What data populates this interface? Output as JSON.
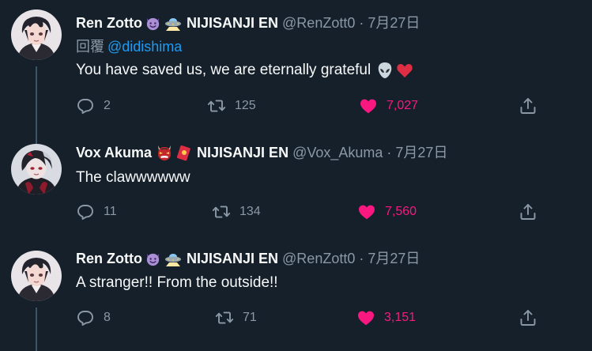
{
  "tweets": [
    {
      "display_name": "Ren Zotto",
      "emojis": [
        "smiling-devil-emoji",
        "ufo-emoji"
      ],
      "org": "NIJISANJI EN",
      "handle": "@RenZott0",
      "separator": "·",
      "date": "7月27日",
      "reply_prefix": "回覆",
      "reply_to": "@didishima",
      "text": "You have saved us, we are eternally grateful",
      "text_emojis": [
        "alien-emoji",
        "red-heart-emoji"
      ],
      "replies": "2",
      "retweets": "125",
      "likes": "7,027",
      "liked": true
    },
    {
      "display_name": "Vox Akuma",
      "emojis": [
        "oni-mask-emoji",
        "red-envelope-emoji"
      ],
      "org": "NIJISANJI EN",
      "handle": "@Vox_Akuma",
      "separator": "·",
      "date": "7月27日",
      "text": "The clawwwwww",
      "replies": "11",
      "retweets": "134",
      "likes": "7,560",
      "liked": true
    },
    {
      "display_name": "Ren Zotto",
      "emojis": [
        "smiling-devil-emoji",
        "ufo-emoji"
      ],
      "org": "NIJISANJI EN",
      "handle": "@RenZott0",
      "separator": "·",
      "date": "7月27日",
      "text": "A stranger!! From the outside!!",
      "replies": "8",
      "retweets": "71",
      "likes": "3,151",
      "liked": true
    }
  ],
  "colors": {
    "background": "#15202b",
    "primary_text": "#f7f9f9",
    "secondary_text": "#8b98a5",
    "link": "#1d9bf0",
    "like": "#f91880",
    "thread_line": "#3d5466"
  },
  "icons": {
    "reply": "reply-icon",
    "retweet": "retweet-icon",
    "like": "heart-icon",
    "share": "share-icon"
  }
}
